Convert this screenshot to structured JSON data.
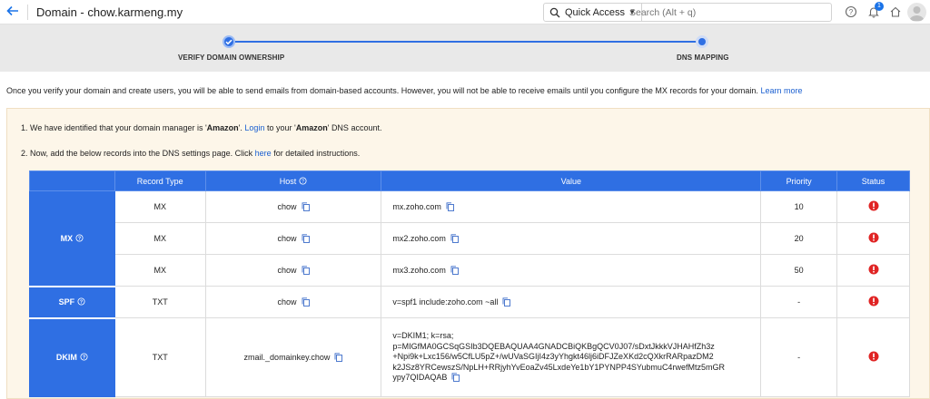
{
  "header": {
    "title": "Domain - chow.karmeng.my",
    "quick_access": "Quick Access",
    "search_placeholder": "Search (Alt + q)",
    "notification_count": "1"
  },
  "stepper": {
    "step1": "VERIFY DOMAIN OWNERSHIP",
    "step2": "DNS MAPPING"
  },
  "intro": {
    "text": "Once you verify your domain and create users, you will be able to send emails from domain-based accounts. However, you will not be able to receive emails until you configure the MX records for your domain.",
    "link": "Learn more"
  },
  "instructions": {
    "line1_a": "1. We have identified that your domain manager is '",
    "line1_manager": "Amazon",
    "line1_b": "'.",
    "line1_link": "Login",
    "line1_c": "to your '",
    "line1_manager2": "Amazon",
    "line1_d": "' DNS account.",
    "line2_a": "2. Now, add the below records into the DNS settings page. Click",
    "line2_link": "here",
    "line2_b": "for detailed instructions."
  },
  "table": {
    "headers": {
      "record_type": "Record Type",
      "host": "Host",
      "value": "Value",
      "priority": "Priority",
      "status": "Status"
    },
    "groups": {
      "mx": "MX",
      "spf": "SPF",
      "dkim": "DKIM"
    },
    "rows": [
      {
        "type": "MX",
        "host": "chow",
        "value": "mx.zoho.com",
        "priority": "10"
      },
      {
        "type": "MX",
        "host": "chow",
        "value": "mx2.zoho.com",
        "priority": "20"
      },
      {
        "type": "MX",
        "host": "chow",
        "value": "mx3.zoho.com",
        "priority": "50"
      },
      {
        "type": "TXT",
        "host": "chow",
        "value": "v=spf1 include:zoho.com ~all",
        "priority": "-"
      },
      {
        "type": "TXT",
        "host": "zmail._domainkey.chow",
        "priority": "-",
        "value_lines": [
          "v=DKIM1; k=rsa;",
          "p=MIGfMA0GCSqGSIb3DQEBAQUAA4GNADCBiQKBgQCV0J07/sDxtJkkkVJHAHfZh3z",
          "+Npi9k+Lxc156/w5CfLU5pZ+/wUVaSGIjI4z3yYhgkt46lj6iDFJZeXKd2cQXkrRARpazDM2",
          "k2JSz8YRCewszS/NpLH+RRjyhYvEoaZv45LxdeYe1bY1PYNPP4SYubmuC4rwefMtz5mGR",
          "ypy7QIDAQAB"
        ]
      }
    ]
  },
  "colors": {
    "accent": "#2f6fe3",
    "error": "#e02424",
    "panel_bg": "#fdf6e9"
  }
}
